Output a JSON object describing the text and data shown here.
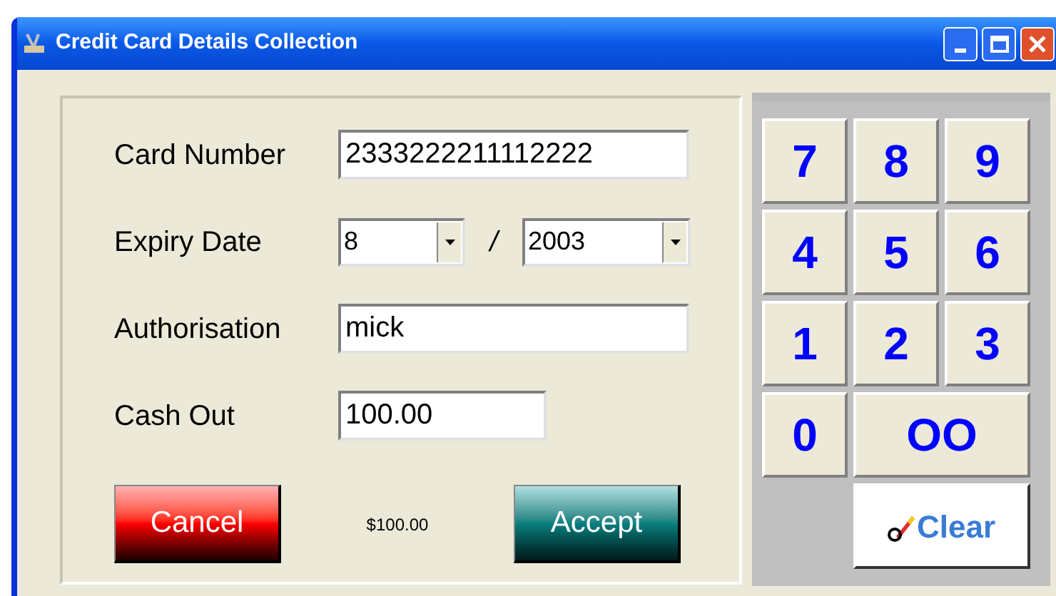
{
  "window": {
    "title": "Credit Card Details Collection"
  },
  "fields": [
    {
      "kind": "text",
      "label": "Card Number",
      "value": "2333222211112222"
    },
    {
      "kind": "date",
      "label": "Expiry Date",
      "month": "8",
      "separator": "/",
      "year": "2003"
    },
    {
      "kind": "text",
      "label": "Authorisation",
      "value": "mick"
    },
    {
      "kind": "short",
      "label": "Cash Out",
      "value": "100.00"
    }
  ],
  "total": "$100.00",
  "buttons": [
    {
      "kind": "cancel",
      "label": "Cancel"
    },
    {
      "kind": "accept",
      "label": "Accept"
    }
  ],
  "keypad": [
    {
      "label": "7",
      "kind": "digit"
    },
    {
      "label": "8",
      "kind": "digit"
    },
    {
      "label": "9",
      "kind": "digit"
    },
    {
      "label": "4",
      "kind": "digit"
    },
    {
      "label": "5",
      "kind": "digit"
    },
    {
      "label": "6",
      "kind": "digit"
    },
    {
      "label": "1",
      "kind": "digit"
    },
    {
      "label": "2",
      "kind": "digit"
    },
    {
      "label": "3",
      "kind": "digit"
    },
    {
      "label": "0",
      "kind": "digit"
    },
    {
      "label": "OO",
      "kind": "wide"
    },
    {
      "label": "Clear",
      "kind": "clear"
    }
  ]
}
